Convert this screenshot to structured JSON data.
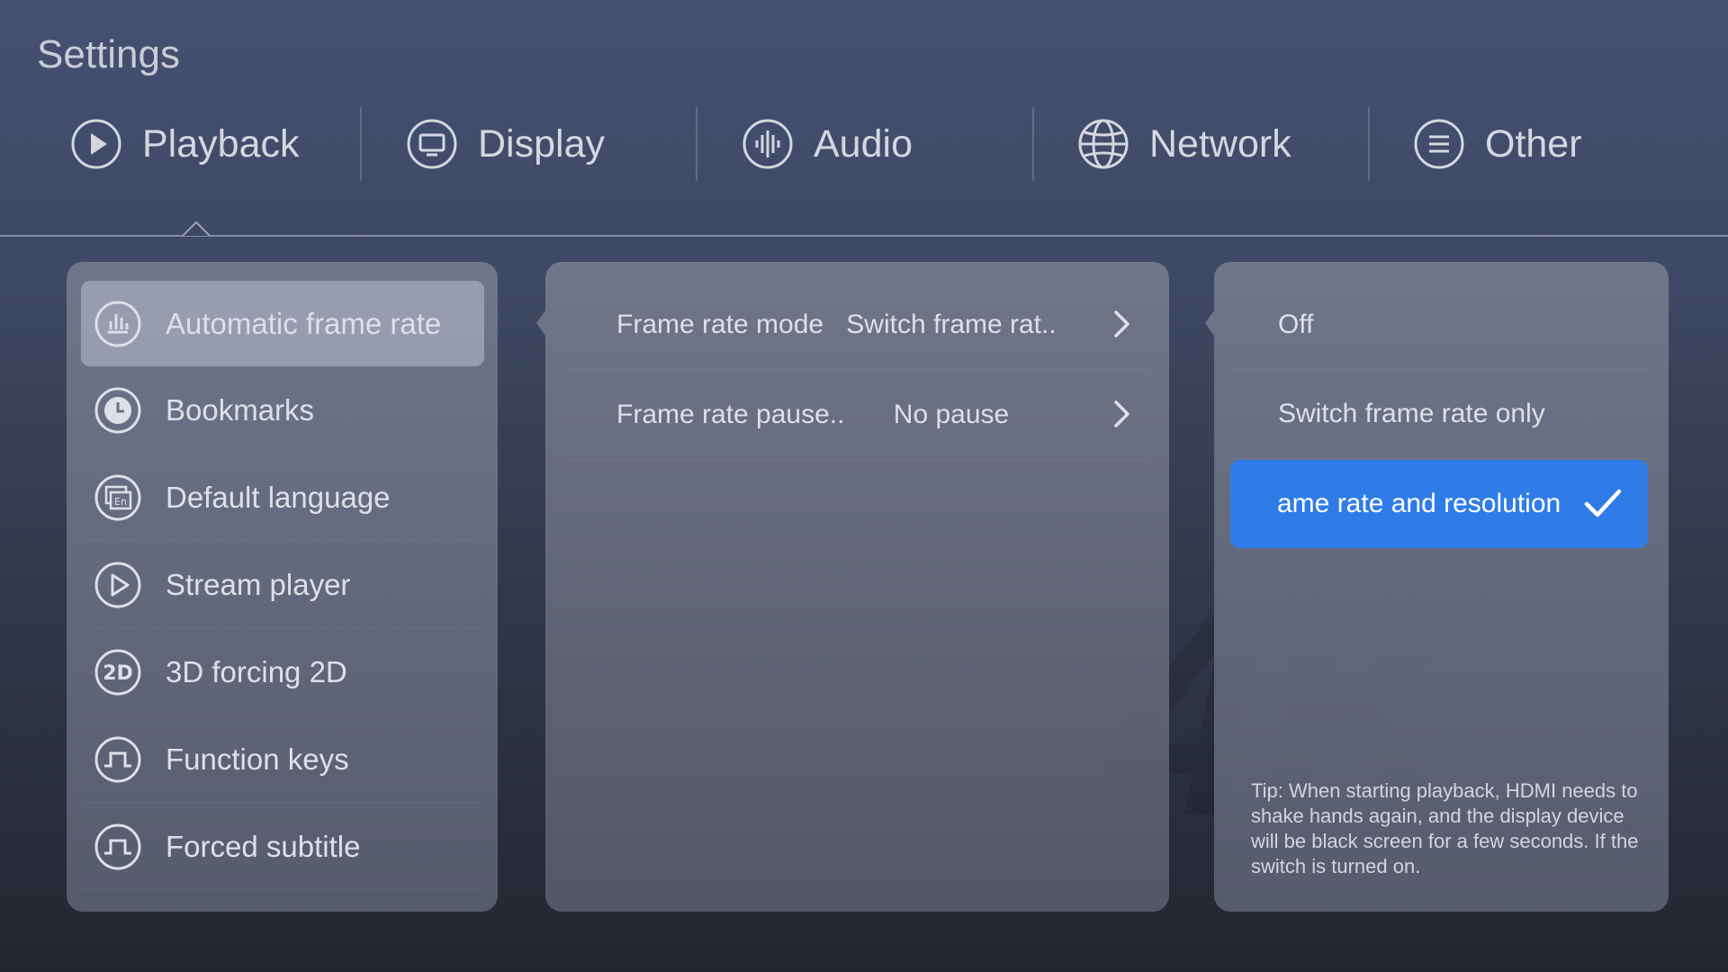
{
  "header": {
    "title": "Settings"
  },
  "tabs": [
    {
      "label": "Playback",
      "icon": "play-circle-icon"
    },
    {
      "label": "Display",
      "icon": "monitor-icon"
    },
    {
      "label": "Audio",
      "icon": "audio-wave-icon"
    },
    {
      "label": "Network",
      "icon": "globe-icon"
    },
    {
      "label": "Other",
      "icon": "menu-lines-icon"
    }
  ],
  "active_tab": "Playback",
  "sidebar": {
    "items": [
      {
        "label": "Automatic frame rate",
        "icon": "bar-chart-icon"
      },
      {
        "label": "Bookmarks",
        "icon": "clock-icon"
      },
      {
        "label": "Default language",
        "icon": "language-icon"
      },
      {
        "label": "Stream player",
        "icon": "play-circle-icon"
      },
      {
        "label": "3D forcing 2D",
        "icon": "2d-icon"
      },
      {
        "label": "Function keys",
        "icon": "pulse-icon"
      },
      {
        "label": "Forced subtitle",
        "icon": "pulse-icon"
      }
    ],
    "active_item": "Automatic frame rate"
  },
  "options": {
    "rows": [
      {
        "label": "Frame rate mode",
        "value": "Switch frame rat.."
      },
      {
        "label": "Frame rate pause..",
        "value": "No pause"
      }
    ]
  },
  "choices": {
    "items": [
      {
        "label": "Off"
      },
      {
        "label": "Switch frame rate only"
      },
      {
        "label": "ame rate and resolution"
      }
    ],
    "selected_index": 2,
    "tip": "Tip: When starting playback, HDMI needs to shake hands again, and the display device will be black screen for a few seconds. If the switch is turned on."
  },
  "colors": {
    "accent": "#2f7ce8",
    "text": "#dde0e7"
  }
}
